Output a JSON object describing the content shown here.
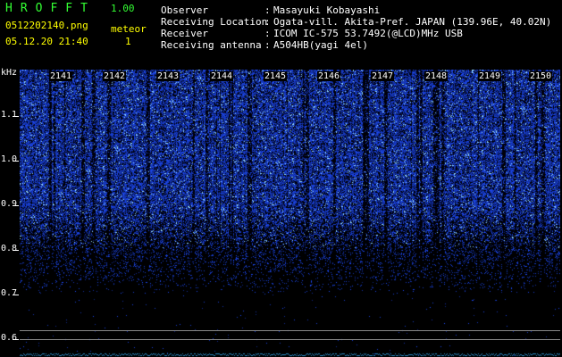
{
  "header": {
    "logo": "HROFFT",
    "version": "1.00",
    "filename": "0512202140.png",
    "datetime": "05.12.20 21:40",
    "meteor_label": "meteor",
    "meteor_count": "1",
    "fields": [
      {
        "label": "Observer",
        "sep": ":",
        "value": "Masayuki Kobayashi"
      },
      {
        "label": "Receiving Location",
        "sep": ":",
        "value": "Ogata-vill. Akita-Pref. JAPAN (139.96E, 40.02N)"
      },
      {
        "label": "Receiver",
        "sep": ":",
        "value": "ICOM IC-575 53.7492(@LCD)MHz USB"
      },
      {
        "label": "Receiving antenna",
        "sep": ":",
        "value": "A504HB(yagi 4el)"
      }
    ]
  },
  "y_axis": {
    "unit": "kHz",
    "ticks": [
      "1.1",
      "1.0",
      "0.9",
      "0.8",
      "0.7",
      "0.6"
    ]
  },
  "x_axis": {
    "ticks": [
      "2141",
      "2142",
      "2143",
      "2144",
      "2145",
      "2146",
      "2147",
      "2148",
      "2149",
      "2150"
    ]
  },
  "colors": {
    "background": "#000000",
    "signal": "#2a5cff",
    "signal_bright": "#9ad8ff",
    "text_yellow": "#ffff00",
    "text_green": "#33ff33"
  }
}
